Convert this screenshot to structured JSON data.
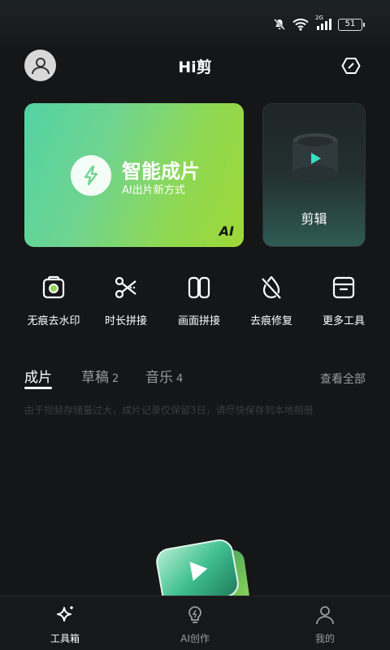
{
  "status_bar": {
    "network": "2G",
    "battery": "51",
    "icons": [
      "mute-icon",
      "wifi-icon",
      "signal-icon",
      "battery-icon"
    ]
  },
  "header": {
    "title": "Hi剪",
    "avatar_icon": "user-avatar-icon",
    "settings_icon": "hexagon-settings-icon"
  },
  "cards": {
    "smart": {
      "title": "智能成片",
      "subtitle": "AI出片新方式",
      "badge": "AI",
      "icon": "lightning-icon"
    },
    "edit": {
      "label": "剪辑",
      "icon": "film-play-icon"
    }
  },
  "tools": [
    {
      "label": "无痕去水印",
      "icon": "watermark-remove-icon"
    },
    {
      "label": "时长拼接",
      "icon": "scissors-icon"
    },
    {
      "label": "画面拼接",
      "icon": "split-frame-icon"
    },
    {
      "label": "去痕修复",
      "icon": "drop-slash-icon"
    },
    {
      "label": "更多工具",
      "icon": "box-icon"
    }
  ],
  "tabs": [
    {
      "label": "成片",
      "count": ""
    },
    {
      "label": "草稿",
      "count": "2"
    },
    {
      "label": "音乐",
      "count": "4"
    }
  ],
  "view_all": "查看全部",
  "notice": "由于视频存储量过大，成片记录仅保留3日，请尽快保存到本地相册",
  "bottom_nav": [
    {
      "label": "工具箱",
      "icon": "sparkle-icon",
      "active": true
    },
    {
      "label": "AI创作",
      "icon": "lightbulb-icon",
      "active": false
    },
    {
      "label": "我的",
      "icon": "person-icon",
      "active": false
    }
  ],
  "colors": {
    "background": "#151618",
    "accent_green": "#8fd852",
    "muted_text": "#9a9b9d"
  }
}
